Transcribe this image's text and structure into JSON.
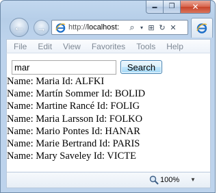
{
  "window": {
    "min_glyph": "▬",
    "max_glyph": "❐",
    "close_glyph": "✕"
  },
  "nav": {
    "back_glyph": "←",
    "forward_glyph": "→"
  },
  "addressbar": {
    "url_prefix": "http://",
    "url_host": "localhost:",
    "search_glyph": "⌕",
    "dropdown_glyph": "▾",
    "compat_glyph": "⊞",
    "refresh_glyph": "↻",
    "stop_glyph": "✕"
  },
  "menu": {
    "items": [
      "File",
      "Edit",
      "View",
      "Favorites",
      "Tools",
      "Help"
    ]
  },
  "search": {
    "value": "mar",
    "button_label": "Search"
  },
  "results": [
    "Name: Maria Id: ALFKI",
    "Name: Martín Sommer Id: BOLID",
    "Name: Martine Rancé Id: FOLIG",
    "Name: Maria Larsson Id: FOLKO",
    "Name: Mario Pontes Id: HANAR",
    "Name: Marie Bertrand Id: PARIS",
    "Name: Mary Saveley Id: VICTE"
  ],
  "statusbar": {
    "zoom": "100%",
    "zoom_dropdown_glyph": "▼"
  },
  "colors": {
    "frame": "#b6cee8",
    "ie_blue": "#1e6fc8",
    "close_red": "#c7432a"
  }
}
